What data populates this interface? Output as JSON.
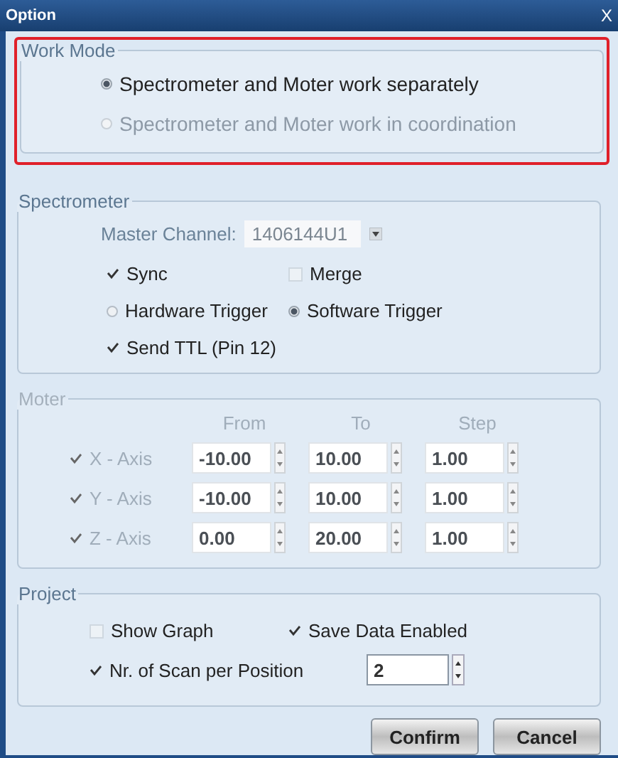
{
  "window": {
    "title": "Option",
    "close": "X"
  },
  "work_mode": {
    "title": "Work Mode",
    "highlighted": true,
    "options": [
      {
        "label": "Spectrometer and Moter work separately",
        "selected": true,
        "disabled": false
      },
      {
        "label": "Spectrometer and Moter work in coordination",
        "selected": false,
        "disabled": true
      }
    ]
  },
  "spectrometer": {
    "title": "Spectrometer",
    "master_channel": {
      "label": "Master Channel:",
      "value": "1406144U1"
    },
    "rows": [
      [
        {
          "kind": "checkbox",
          "label": "Sync",
          "checked": true
        },
        {
          "kind": "checkbox",
          "label": "Merge",
          "checked": false
        }
      ],
      [
        {
          "kind": "radio",
          "label": "Hardware Trigger",
          "selected": false
        },
        {
          "kind": "radio",
          "label": "Software Trigger",
          "selected": true
        }
      ],
      [
        {
          "kind": "checkbox",
          "label": "Send TTL (Pin 12)",
          "checked": true
        }
      ]
    ]
  },
  "moter": {
    "title": "Moter",
    "disabled": true,
    "columns": [
      "From",
      "To",
      "Step"
    ],
    "axes": [
      {
        "label": "X - Axis",
        "checked": true,
        "values": [
          "-10.00",
          "10.00",
          "1.00"
        ]
      },
      {
        "label": "Y - Axis",
        "checked": true,
        "values": [
          "-10.00",
          "10.00",
          "1.00"
        ]
      },
      {
        "label": "Z - Axis",
        "checked": true,
        "values": [
          "0.00",
          "20.00",
          "1.00"
        ]
      }
    ]
  },
  "project": {
    "title": "Project",
    "options": [
      {
        "label": "Show Graph",
        "checked": false
      },
      {
        "label": "Save Data Enabled",
        "checked": true
      }
    ],
    "scan": {
      "label": "Nr. of Scan per Position",
      "checked": true,
      "value": "2"
    }
  },
  "buttons": [
    "Confirm",
    "Cancel"
  ]
}
